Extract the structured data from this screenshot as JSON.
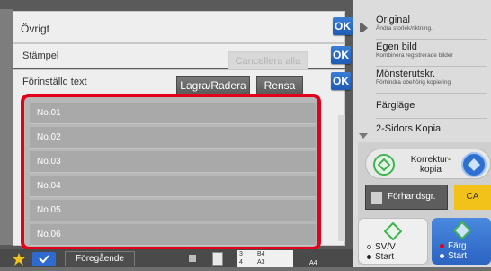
{
  "dialog": {
    "title": "Övrigt",
    "ok_label": "OK",
    "stamp": {
      "label": "Stämpel",
      "cancel_all_label": "Cancellera alla",
      "ok_label": "OK"
    },
    "preset_text": {
      "label": "Förinställd text",
      "save_delete_label": "Lagra/Radera",
      "clear_label": "Rensa",
      "ok_label": "OK"
    },
    "list_items": [
      "No.01",
      "No.02",
      "No.03",
      "No.04",
      "No.05",
      "No.06"
    ]
  },
  "right_menu": {
    "items": [
      {
        "label": "Original",
        "sub": "Ändra storlek/riktning."
      },
      {
        "label": "Egen bild",
        "sub": "Kombinera registrerade bilder"
      },
      {
        "label": "Mönsterutskr.",
        "sub": "Förhindra obehörig kopiering"
      },
      {
        "label": "Färgläge",
        "sub": ""
      },
      {
        "label": "2-Sidors Kopia",
        "sub": ""
      }
    ]
  },
  "controls": {
    "proof_copy_label": "Korrektur-\nkopia",
    "preview_label": "Förhandsgr.",
    "ca_label": "CA",
    "bw_start_label_1": "SV/V",
    "bw_start_label_2": "Start",
    "color_start_label_1": "Färg",
    "color_start_label_2": "Start"
  },
  "bottom_bar": {
    "previous_label": "Föregående",
    "tray_rows": [
      {
        "num": "3",
        "size": "B4"
      },
      {
        "num": "4",
        "size": "A3"
      }
    ],
    "paper_size": "A4"
  },
  "colors": {
    "ok_blue": "#2a6ac8",
    "highlight_red": "#e2001a",
    "ca_yellow": "#f2c21b",
    "start_green": "#3fb34f"
  }
}
